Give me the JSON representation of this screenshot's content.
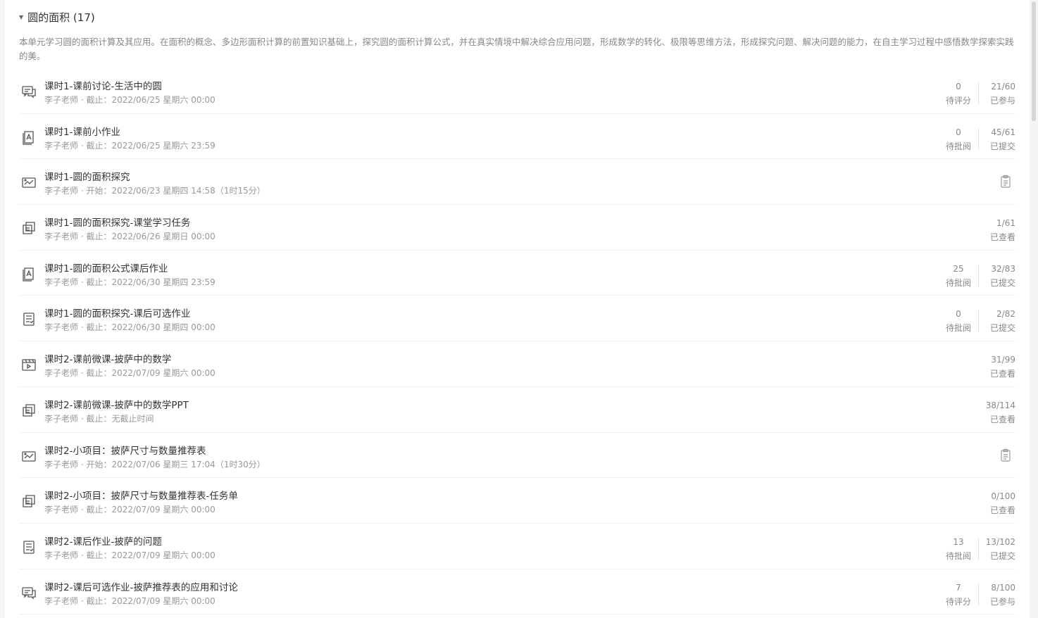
{
  "unit": {
    "title": "圆的面积 (17)",
    "description": "本单元学习圆的面积计算及其应用。在面积的概念、多边形面积计算的前置知识基础上，探究圆的面积计算公式，并在真实情境中解决综合应用问题，形成数学的转化、极限等思维方法，形成探究问题、解决问题的能力，在自主学习过程中感悟数学探索实践的美。"
  },
  "items": [
    {
      "icon": "discussion-icon",
      "title": "课时1-课前讨论-生活中的圆",
      "meta": "李子老师 · 截止：2022/06/25 星期六 00:00",
      "pending_num": "0",
      "pending_label": "待评分",
      "done_num": "21/60",
      "done_label": "已参与"
    },
    {
      "icon": "homework-icon",
      "title": "课时1-课前小作业",
      "meta": "李子老师 · 截止：2022/06/25 星期六 23:59",
      "pending_num": "0",
      "pending_label": "待批阅",
      "done_num": "45/61",
      "done_label": "已提交"
    },
    {
      "icon": "whiteboard-icon",
      "title": "课时1-圆的面积探究",
      "meta": "李子老师 · 开始：2022/06/23 星期四 14:58（1时15分）",
      "clip": true
    },
    {
      "icon": "resource-icon",
      "title": "课时1-圆的面积探究-课堂学习任务",
      "meta": "李子老师 · 截止：2022/06/26 星期日 00:00",
      "done_num": "1/61",
      "done_label": "已查看"
    },
    {
      "icon": "homework-icon",
      "title": "课时1-圆的面积公式课后作业",
      "meta": "李子老师 · 截止：2022/06/30 星期四 23:59",
      "pending_num": "25",
      "pending_label": "待批阅",
      "done_num": "32/83",
      "done_label": "已提交"
    },
    {
      "icon": "test-icon",
      "title": "课时1-圆的面积探究-课后可选作业",
      "meta": "李子老师 · 截止：2022/06/30 星期四 00:00",
      "pending_num": "0",
      "pending_label": "待批阅",
      "done_num": "2/82",
      "done_label": "已提交"
    },
    {
      "icon": "video-icon",
      "title": "课时2-课前微课-披萨中的数学",
      "meta": "李子老师 · 截止：2022/07/09 星期六 00:00",
      "done_num": "31/99",
      "done_label": "已查看"
    },
    {
      "icon": "resource-icon",
      "title": "课时2-课前微课-披萨中的数学PPT",
      "meta": "李子老师 · 截止：无截止时间",
      "done_num": "38/114",
      "done_label": "已查看"
    },
    {
      "icon": "whiteboard-icon",
      "title": "课时2-小项目：披萨尺寸与数量推荐表",
      "meta": "李子老师 · 开始：2022/07/06 星期三 17:04（1时30分）",
      "clip": true
    },
    {
      "icon": "resource-icon",
      "title": "课时2-小项目：披萨尺寸与数量推荐表-任务单",
      "meta": "李子老师 · 截止：2022/07/09 星期六 00:00",
      "done_num": "0/100",
      "done_label": "已查看"
    },
    {
      "icon": "test-icon",
      "title": "课时2-课后作业-披萨的问题",
      "meta": "李子老师 · 截止：2022/07/09 星期六 00:00",
      "pending_num": "13",
      "pending_label": "待批阅",
      "done_num": "13/102",
      "done_label": "已提交"
    },
    {
      "icon": "discussion-icon",
      "title": "课时2-课后可选作业-披萨推荐表的应用和讨论",
      "meta": "李子老师 · 截止：2022/07/09 星期六 00:00",
      "pending_num": "7",
      "pending_label": "待评分",
      "done_num": "8/100",
      "done_label": "已参与"
    }
  ]
}
